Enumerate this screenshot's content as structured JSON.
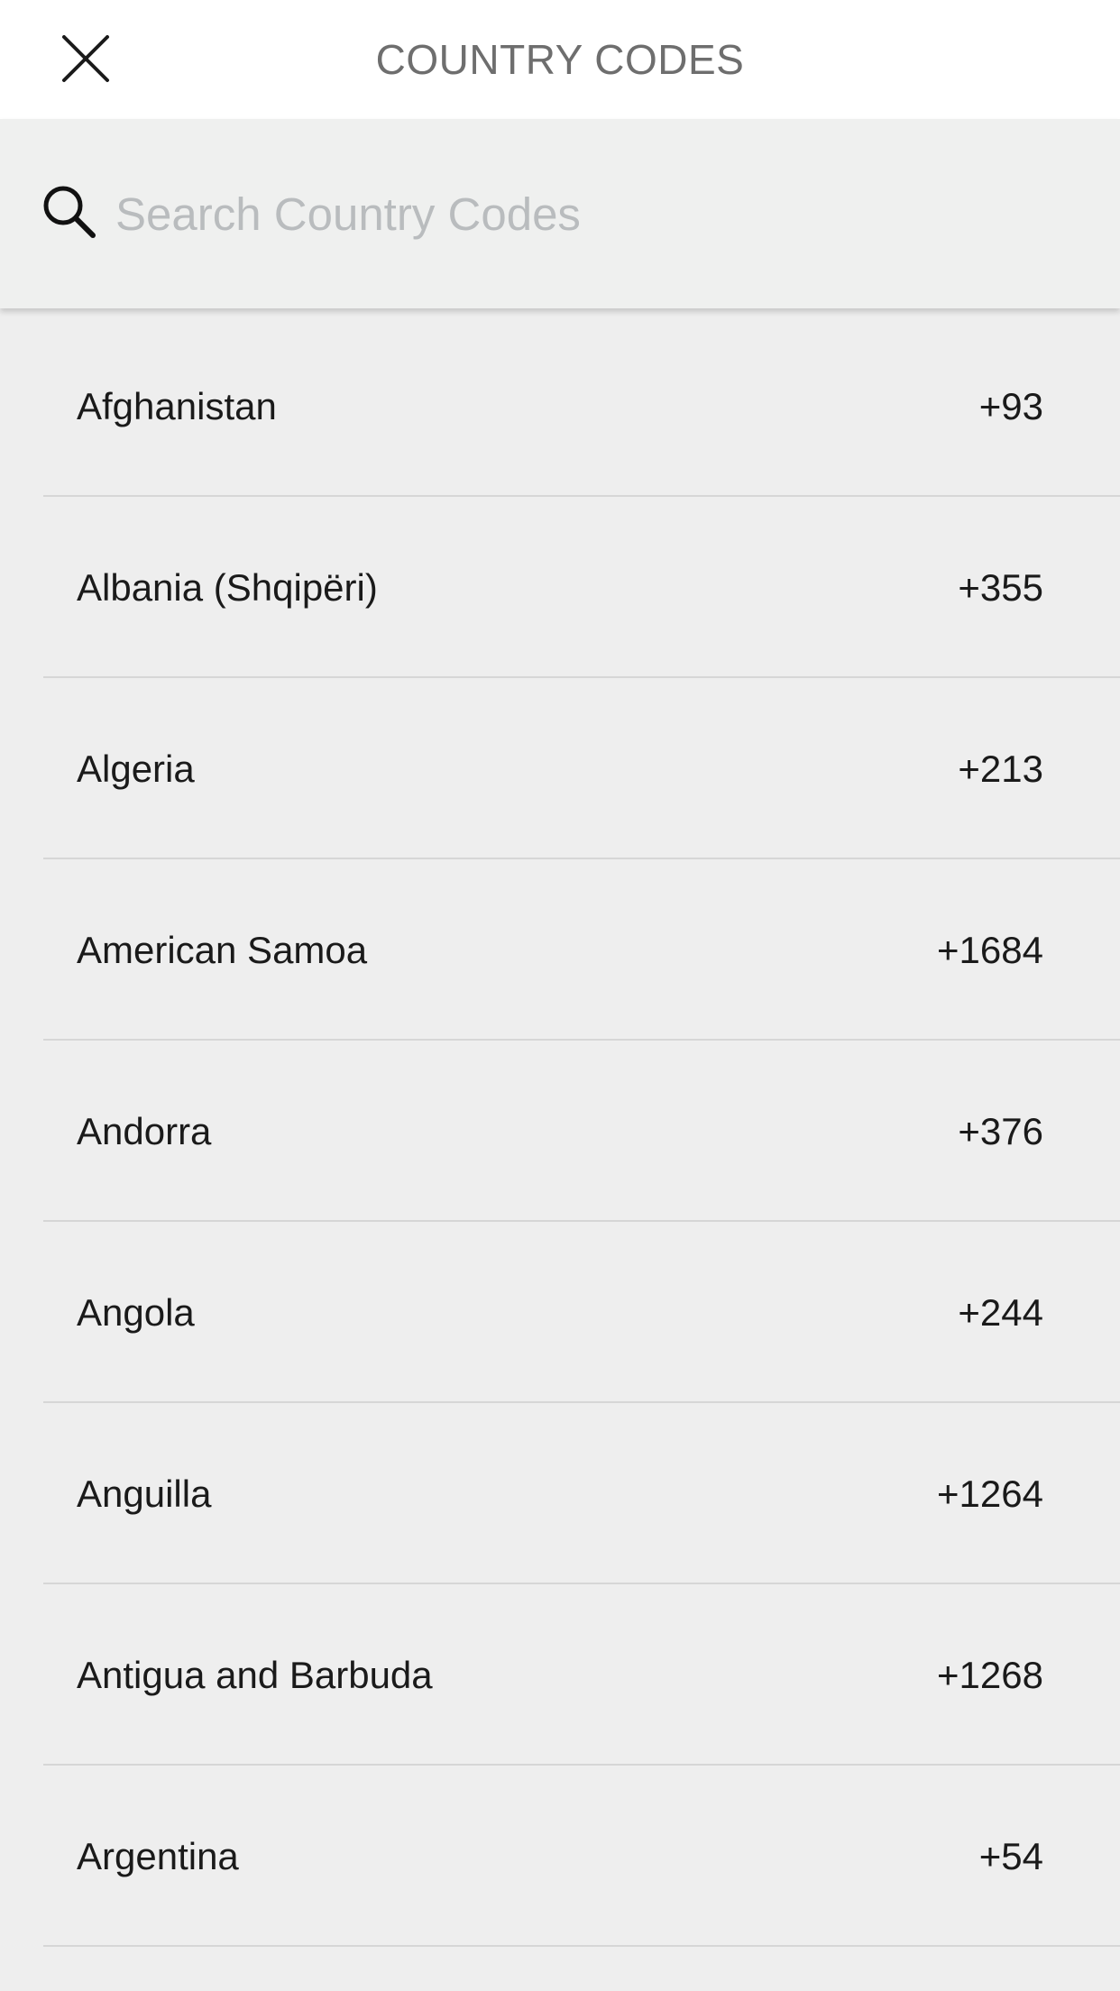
{
  "header": {
    "title": "COUNTRY CODES",
    "close_icon": "close-icon"
  },
  "search": {
    "placeholder": "Search Country Codes",
    "value": "",
    "icon": "search-icon"
  },
  "countries": [
    {
      "name": "Afghanistan",
      "code": "+93"
    },
    {
      "name": "Albania (Shqipëri)",
      "code": "+355"
    },
    {
      "name": "Algeria",
      "code": "+213"
    },
    {
      "name": "American Samoa",
      "code": "+1684"
    },
    {
      "name": "Andorra",
      "code": "+376"
    },
    {
      "name": "Angola",
      "code": "+244"
    },
    {
      "name": "Anguilla",
      "code": "+1264"
    },
    {
      "name": "Antigua and Barbuda",
      "code": "+1268"
    },
    {
      "name": "Argentina",
      "code": "+54"
    }
  ],
  "colors": {
    "header_bg": "#ffffff",
    "title_text": "#6e6e6e",
    "search_bg": "#eff0ef",
    "placeholder": "#b9bcbe",
    "list_bg": "#eeeeee",
    "row_text": "#1a1a1a",
    "divider": "#d6d6d6"
  }
}
